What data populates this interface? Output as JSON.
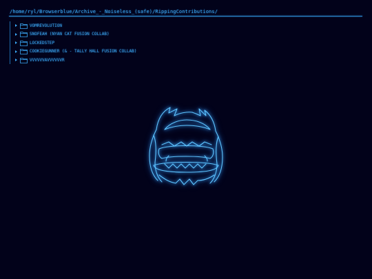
{
  "path": "/home/ryl/Browserblue/Archive_-_Noiseless_(safe)/RippingContributions/",
  "tree": {
    "items": [
      {
        "label": "VOMREVOLUTION"
      },
      {
        "label": "SNOFEAH (NYAN CAT FUSION COLLAB)"
      },
      {
        "label": "LOCKEDSTEP"
      },
      {
        "label": "COOKIEGUNNER (& - TALLY HALL FUSION COLLAB)"
      },
      {
        "label": "VVVVVVAVVVVVVR"
      }
    ]
  },
  "colors": {
    "background": "#02021a",
    "accent": "#3aa6f2"
  },
  "icons": {
    "expand": "chevron-right-icon",
    "folder": "folder-icon",
    "mascot": "mascot-outline"
  }
}
